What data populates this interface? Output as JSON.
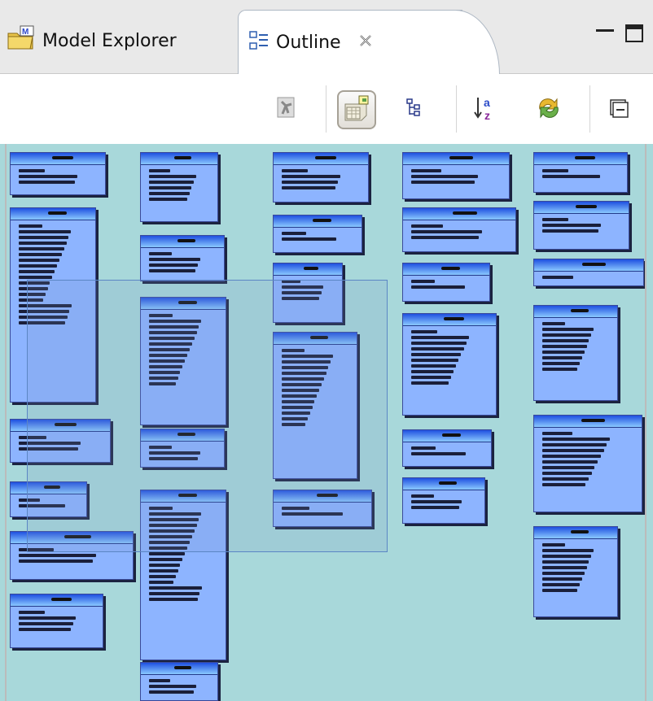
{
  "tabs": {
    "model_explorer": {
      "label": "Model Explorer",
      "icon": "folder-model-icon"
    },
    "outline": {
      "label": "Outline",
      "icon": "outline-icon",
      "close": "close-icon"
    }
  },
  "window_controls": {
    "minimize": "minimize-icon",
    "maximize": "maximize-icon"
  },
  "toolbar": {
    "buttons": [
      {
        "name": "filter-icon",
        "selected": false
      },
      {
        "name": "overview-diagram-icon",
        "selected": true
      },
      {
        "name": "tree-icon",
        "selected": false
      },
      {
        "name": "sort-alpha-icon",
        "selected": false
      },
      {
        "name": "sync-icon",
        "selected": false
      },
      {
        "name": "collapse-all-icon",
        "selected": false
      }
    ]
  },
  "colors": {
    "canvas": "#a8d8da",
    "table_fill": "#8db4ff",
    "table_header": "#1f50e0",
    "viewport_border": "#5b86c4"
  }
}
